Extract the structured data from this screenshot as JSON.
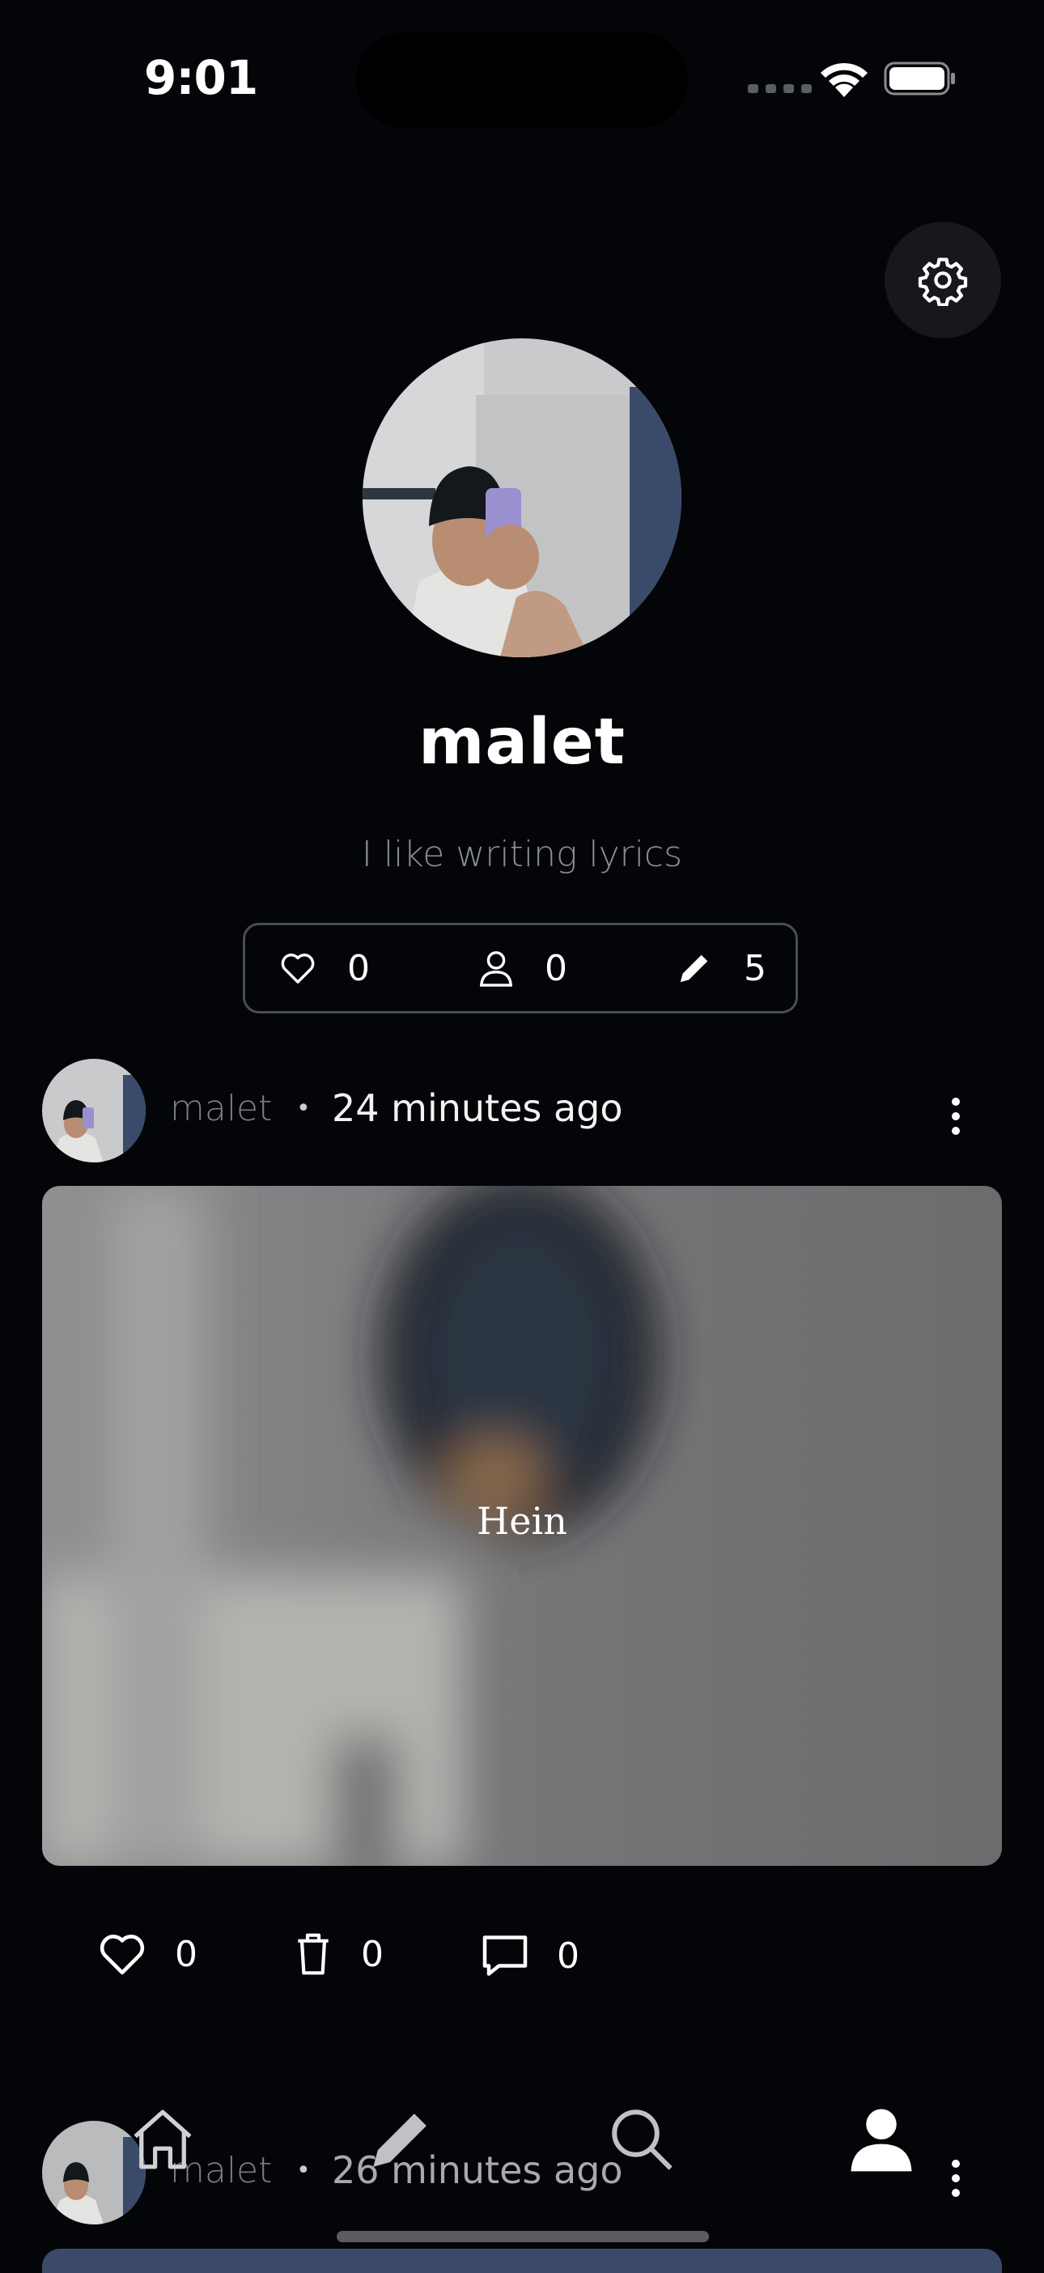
{
  "status_bar": {
    "time": "9:01"
  },
  "profile": {
    "username": "malet",
    "bio": "I like writing lyrics",
    "stats": {
      "likes": "0",
      "followers": "0",
      "posts": "5"
    }
  },
  "posts": [
    {
      "author": "malet",
      "separator": "•",
      "time_ago": "24 minutes ago",
      "caption": "Hein",
      "actions": {
        "likes": "0",
        "deletes": "0",
        "comments": "0"
      }
    },
    {
      "author": "malet",
      "separator": "•",
      "time_ago": "26 minutes ago"
    }
  ],
  "nav": {
    "items": [
      {
        "icon": "home-icon"
      },
      {
        "icon": "pencil-icon"
      },
      {
        "icon": "search-icon"
      },
      {
        "icon": "user-icon",
        "active": true
      }
    ]
  }
}
